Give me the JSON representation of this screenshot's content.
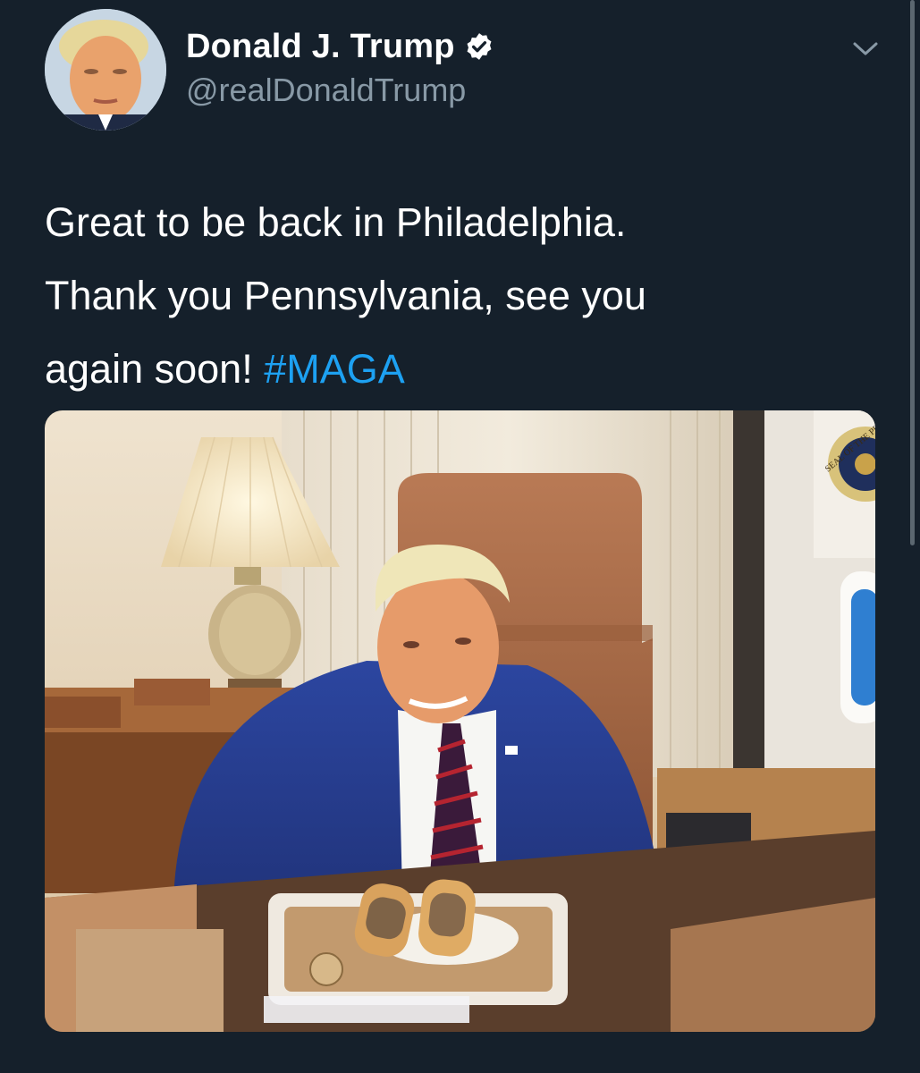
{
  "tweet": {
    "author": {
      "display_name": "Donald J. Trump",
      "handle": "@realDonaldTrump",
      "verified": true,
      "avatar_icon": "profile-photo"
    },
    "text_lines": [
      "Great to be back in Philadelphia.",
      "Thank you Pennsylvania, see you"
    ],
    "text_last_line_prefix": "again soon! ",
    "hashtag": "#MAGA",
    "menu_icon": "chevron-down-icon",
    "media": {
      "type": "photo",
      "seal_text": "SEAL OF THE PRESIDENT"
    }
  },
  "colors": {
    "background": "#15202b",
    "text": "#ffffff",
    "secondary_text": "#8899a6",
    "link": "#1da1f2"
  }
}
